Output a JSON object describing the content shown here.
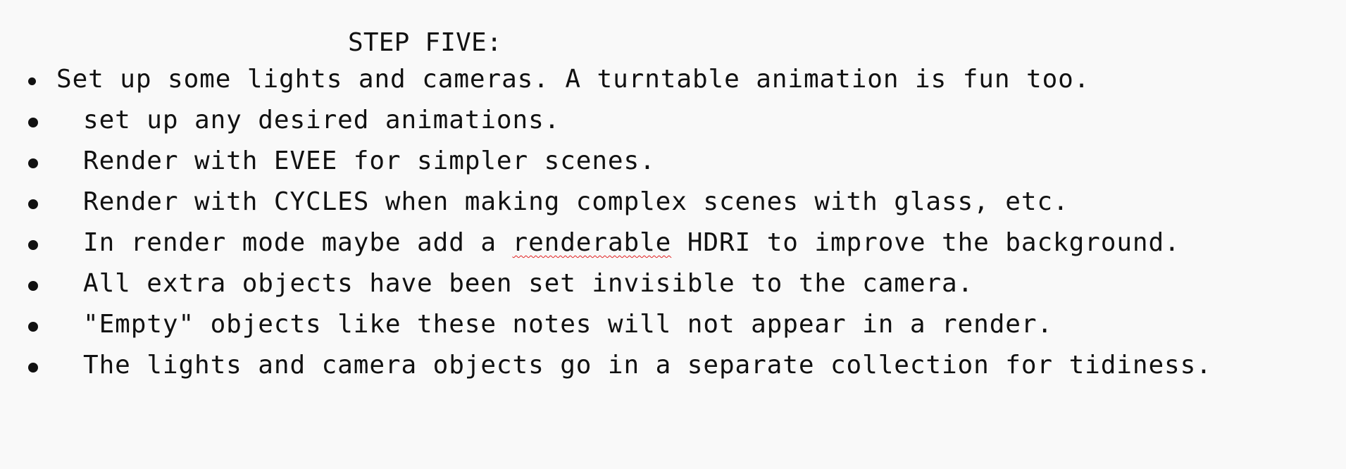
{
  "document": {
    "heading": "STEP FIVE:",
    "bullets": [
      {
        "text": "Set up some lights and cameras. A turntable animation is fun too."
      },
      {
        "text": "set up any desired animations."
      },
      {
        "text": "Render with EVEE for simpler scenes."
      },
      {
        "text": "Render with CYCLES when making complex scenes with glass, etc."
      },
      {
        "before": "In render mode maybe add a ",
        "flagged_word": "renderable",
        "after": " HDRI to improve the background."
      },
      {
        "text": "All extra objects have been set invisible to the camera."
      },
      {
        "text": "\"Empty\" objects like these notes will not appear in a render."
      },
      {
        "text": "The lights and camera objects go in a separate collection for tidiness."
      }
    ]
  },
  "colors": {
    "background": "#f9f9f9",
    "text": "#111111",
    "spellcheck_underline": "#e02020"
  }
}
